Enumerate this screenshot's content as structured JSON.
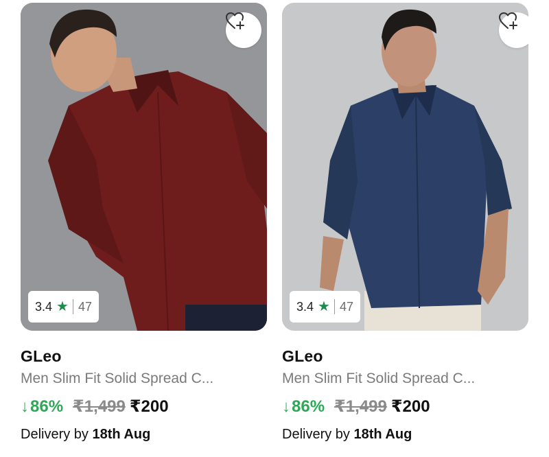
{
  "products": [
    {
      "brand": "GLeo",
      "title": "Men Slim Fit Solid Spread C...",
      "rating": "3.4",
      "rating_count": "47",
      "discount": "86%",
      "mrp": "₹1,499",
      "price": "₹200",
      "delivery_prefix": "Delivery by",
      "delivery_date": "18th Aug",
      "shirt_color": "#6e1d1c"
    },
    {
      "brand": "GLeo",
      "title": "Men Slim Fit Solid Spread C...",
      "rating": "3.4",
      "rating_count": "47",
      "discount": "86%",
      "mrp": "₹1,499",
      "price": "₹200",
      "delivery_prefix": "Delivery by",
      "delivery_date": "18th Aug",
      "shirt_color": "#2c3f66"
    }
  ],
  "colors": {
    "discount_green": "#2ea857",
    "star_green": "#1f8a4c",
    "muted_text": "#7a7a7a"
  },
  "icons": {
    "wishlist": "heart-plus-icon",
    "rating": "star-icon",
    "discount": "down-arrow-icon"
  }
}
